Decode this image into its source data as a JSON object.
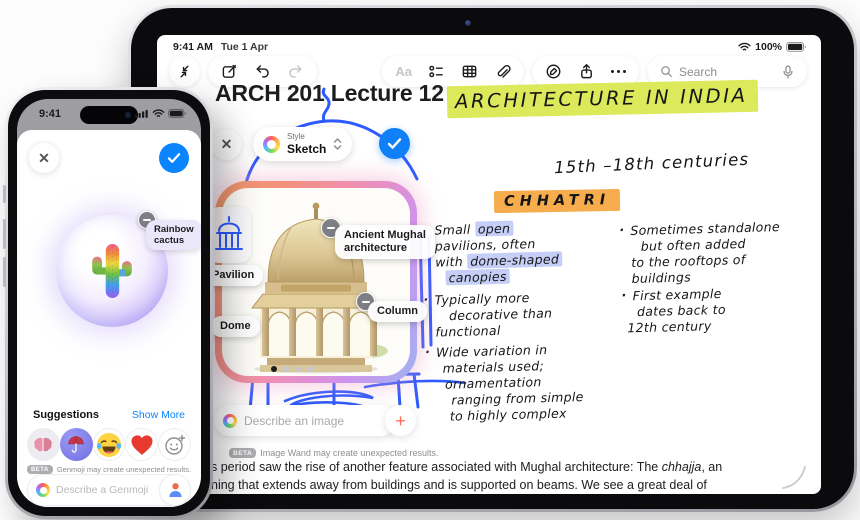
{
  "ipad": {
    "status_bar": {
      "time": "9:41 AM",
      "date": "Tue 1 Apr",
      "battery_pct": "100%"
    },
    "toolbar": {
      "format_label": "Aa",
      "search_placeholder": "Search"
    },
    "note": {
      "title": "ARCH 201 Lecture 12",
      "body_line1_pre": "s period saw the rise of another feature associated with Mughal architecture: The ",
      "body_line1_italic": "chhajja",
      "body_line1_post": ", an",
      "body_line2": "ning that extends away from buildings and is supported on beams. We see a great deal of"
    },
    "image_wand": {
      "style_label": "Style",
      "style_value": "Sketch",
      "tag_main_line1": "Ancient Mughal",
      "tag_main_line2": "architecture",
      "tag_column": "Column",
      "tag_dome": "Dome",
      "tag_pavilion": "Pavilion",
      "describe_placeholder": "Describe an image",
      "plus_label": "+",
      "beta_badge": "BETA",
      "beta_text": "Image Wand may create unexpected results."
    },
    "handwriting": {
      "title": "ARCHITECTURE IN INDIA",
      "subtitle": "15th –18th centuries",
      "heading": "CHHATRI",
      "left_bullets": [
        {
          "lines": [
            {
              "pre": "Small ",
              "hl": "open"
            },
            {
              "pre": "pavilions, often"
            },
            {
              "pre": "with ",
              "hl": "dome-shaped"
            },
            {
              "hl": "canopies"
            }
          ]
        },
        {
          "lines": [
            {
              "pre": "Typically more"
            },
            {
              "pre": "decorative than"
            },
            {
              "pre": "functional"
            }
          ]
        },
        {
          "lines": [
            {
              "pre": "Wide variation in"
            },
            {
              "pre": "materials used;"
            },
            {
              "pre": "ornamentation"
            },
            {
              "pre": "ranging from simple"
            },
            {
              "pre": "to highly complex"
            }
          ]
        }
      ],
      "right_bullets": [
        {
          "lines": [
            {
              "pre": "Sometimes standalone"
            },
            {
              "pre": "but often added"
            },
            {
              "pre": "to the rooftops of"
            },
            {
              "pre": "buildings"
            }
          ]
        },
        {
          "lines": [
            {
              "pre": "First example"
            },
            {
              "pre": "dates back to"
            },
            {
              "pre": "12th century"
            }
          ]
        }
      ]
    }
  },
  "iphone": {
    "status_time": "9:41",
    "genmoji": {
      "tag_line1": "Rainbow",
      "tag_line2": "cactus",
      "suggestions_title": "Suggestions",
      "show_more": "Show More",
      "beta_badge": "BETA",
      "beta_text": "Genmoji may create unexpected results.",
      "describe_placeholder": "Describe a Genmoji"
    }
  },
  "colors": {
    "accent_blue": "#0a84ff",
    "highlight_yellow": "#dce95a",
    "highlight_orange": "#f7ac4d",
    "highlight_periwinkle": "#c5cef6",
    "sketch_blue": "#2e5bff"
  }
}
